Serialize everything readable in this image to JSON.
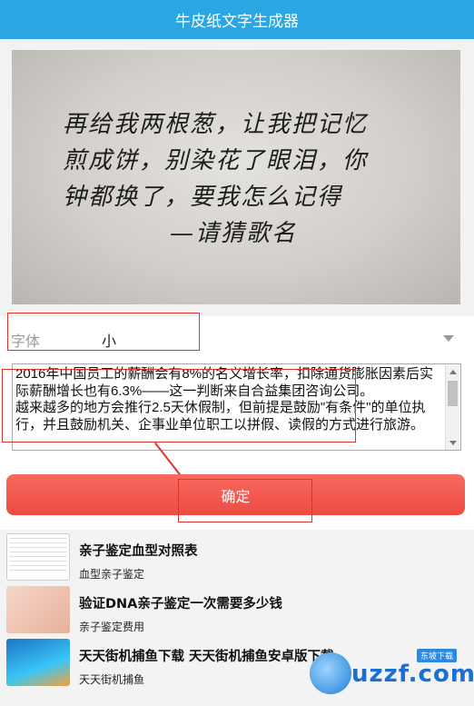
{
  "header": {
    "title": "牛皮纸文字生成器"
  },
  "hero": {
    "lines": [
      "再给我两根葱，让我把记忆",
      "煎成饼，别染花了眼泪，你",
      "钟都换了，要我怎么记得",
      "—请猜歌名"
    ]
  },
  "font_select": {
    "label": "字体",
    "value": "小"
  },
  "textarea": {
    "value": "2016年中国员工的薪酬会有8%的名义增长率，扣除通货膨胀因素后实际薪酬增长也有6.3%——这一判断来自合益集团咨询公司。\n越来越多的地方会推行2.5天休假制，但前提是鼓励\"有条件\"的单位执行，并且鼓励机关、企事业单位职工以拼假、读假的方式进行旅游。"
  },
  "confirm_button": {
    "label": "确定"
  },
  "list": [
    {
      "title": "亲子鉴定血型对照表",
      "sub": "血型亲子鉴定",
      "icon": "blood-type-table-thumbnail"
    },
    {
      "title": "验证DNA亲子鉴定一次需要多少钱",
      "sub": "亲子鉴定费用",
      "icon": "dna-test-thumbnail"
    },
    {
      "title": "天天街机捕鱼下载 天天街机捕鱼安卓版下载",
      "sub": "天天街机捕鱼",
      "icon": "fishing-game-thumbnail"
    }
  ],
  "watermark": {
    "text": "uzzf.com",
    "badge": "东坡下载"
  },
  "colors": {
    "header": "#2aa7e2",
    "button": "#ec4c42",
    "annotation": "#e0342a"
  }
}
